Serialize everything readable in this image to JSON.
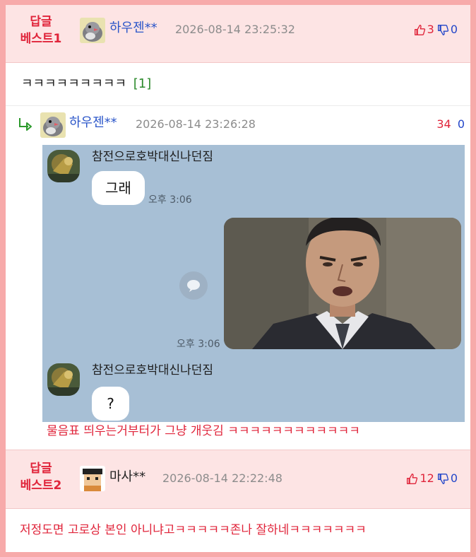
{
  "comments": [
    {
      "best_label": "답글\n베스트1",
      "best_label_line1": "답글",
      "best_label_line2": "베스트1",
      "nickname": "하우젠**",
      "date": "2026-08-14 23:25:32",
      "upvotes": "3",
      "downvotes": "0",
      "text": "ㅋㅋㅋㅋㅋㅋㅋㅋㅋ",
      "reply_count": "[1]"
    },
    {
      "best_label_line1": "답글",
      "best_label_line2": "베스트2",
      "nickname": "마사**",
      "date": "2026-08-14 22:22:48",
      "upvotes": "12",
      "downvotes": "0",
      "text": "저정도면 고로상 본인 아니냐고ㅋㅋㅋㅋㅋ존나 잘하네ㅋㅋㅋㅋㅋㅋㅋ"
    }
  ],
  "reply": {
    "arrow": "↳",
    "nickname": "하우젠**",
    "date": "2026-08-14 23:26:28",
    "upvotes": "34",
    "downvotes": "0",
    "caption": "물음표 띄우는거부터가 그냥 개웃김 ㅋㅋㅋㅋㅋㅋㅋㅋㅋㅋㅋㅋ"
  },
  "chat_image": {
    "sender_name_1": "참전으로호박대신나던짐",
    "message_1": "그래",
    "time_1": "오후 3:06",
    "time_2": "오후 3:06",
    "sender_name_2": "참전으로호박대신나던짐",
    "message_2": "?"
  },
  "colors": {
    "background": "#f7aaaa",
    "best_label": "#e0243a",
    "nickname": "#2b56c9",
    "upvote": "#e0243a",
    "downvote": "#2346c9",
    "chat_bg": "#a7bfd5"
  },
  "icons": [
    "thumbs-up-icon",
    "thumbs-down-icon",
    "reply-arrow-icon",
    "share-icon"
  ]
}
